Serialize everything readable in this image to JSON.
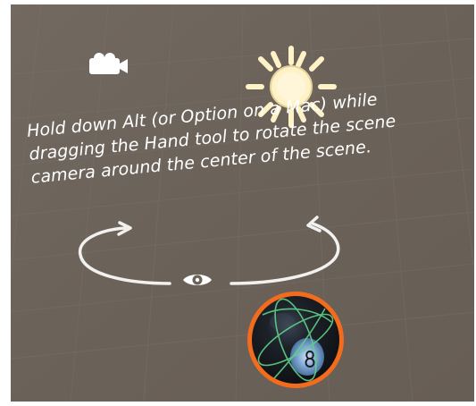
{
  "annotation": {
    "lines": [
      "Hold down Alt (or Option on a Mac) while",
      "dragging the Hand tool to rotate the scene",
      "camera around the center of the scene."
    ]
  },
  "icons": {
    "camera": "camera-icon",
    "light": "sun-icon",
    "view": "eye-icon",
    "orbit_arrows": "curved-arrow-icon",
    "selection": "sphere-icon"
  },
  "colors": {
    "scene_background": "#6b6259",
    "grid_line": "#7b726a",
    "annotation_text": "#ffffff",
    "sun_fill": "#fff2c7",
    "sun_outline": "#e7d39c",
    "selection_outline": "#f1681d",
    "sphere_fill": "#16181d",
    "sphere_highlight": "#77a6d7",
    "wire_green": "#60d28a"
  }
}
